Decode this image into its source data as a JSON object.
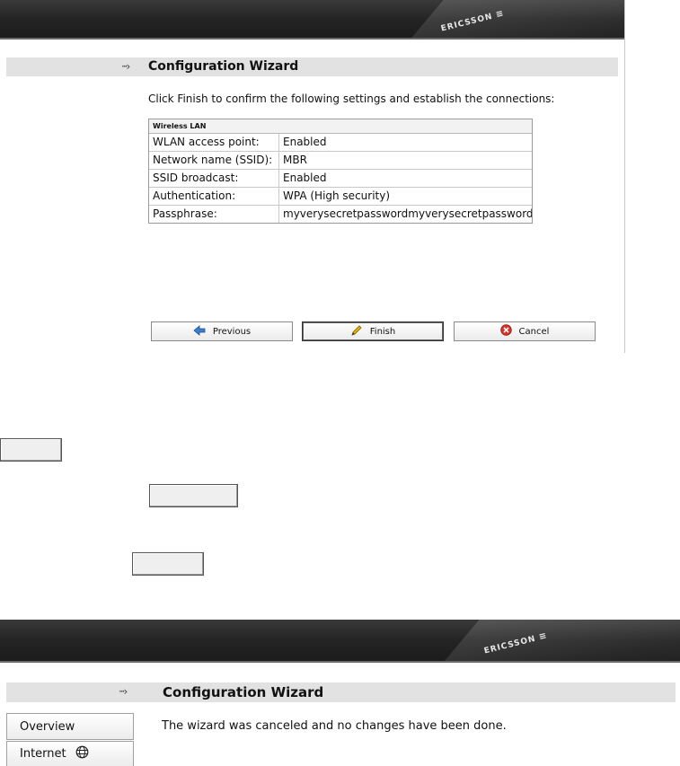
{
  "screen1": {
    "brand": "ERICSSON",
    "title": "Configuration Wizard",
    "instruction": "Click Finish to confirm the following settings and establish the connections:",
    "wlan_section": "Wireless LAN",
    "rows": [
      {
        "label": "WLAN access point:",
        "value": "Enabled"
      },
      {
        "label": "Network name (SSID):",
        "value": "MBR"
      },
      {
        "label": "SSID broadcast:",
        "value": "Enabled"
      },
      {
        "label": "Authentication:",
        "value": "WPA (High security)"
      },
      {
        "label": "Passphrase:",
        "value": "myverysecretpasswordmyverysecretpassword"
      }
    ],
    "buttons": {
      "previous": "Previous",
      "finish": "Finish",
      "cancel": "Cancel"
    }
  },
  "screen2": {
    "brand": "ERICSSON",
    "title": "Configuration Wizard",
    "message": "The wizard was canceled and no changes have been done.",
    "sidebar": [
      "Overview",
      "Internet"
    ]
  },
  "icons": {
    "arrow": "dotted-arrow-icon",
    "previous": "arrow-left-icon",
    "finish": "pencil-icon",
    "cancel": "cancel-x-icon",
    "internet": "globe-icon"
  },
  "colors": {
    "banner": "#242424",
    "title_bar": "#e2e2e2",
    "cancel_icon": "#d9342b",
    "previous_icon": "#3a7ecf",
    "finish_icon": "#e6b800"
  }
}
